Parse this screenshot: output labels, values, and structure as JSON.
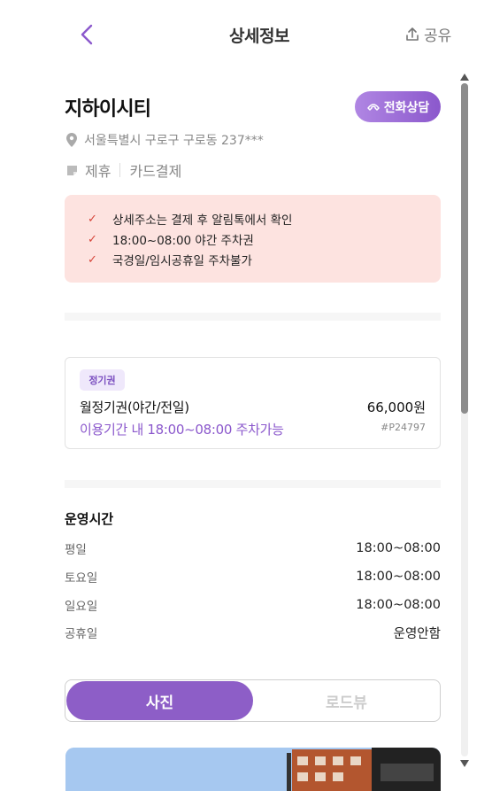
{
  "header": {
    "title": "상세정보",
    "share_label": "공유",
    "back_icon": "chevron-left-icon",
    "share_icon": "upload-icon"
  },
  "place": {
    "name": "지하이시티",
    "call_button_label": "전화상담",
    "address": "서울특별시 구로구 구로동 237***",
    "tags": [
      "제휴",
      "카드결제"
    ]
  },
  "notices": [
    "상세주소는 결제 후 알림톡에서 확인",
    "18:00~08:00 야간 주차권",
    "국경일/임시공휴일 주차불가"
  ],
  "pass": {
    "badge": "정기권",
    "name": "월정기권(야간/전일)",
    "price": "66,000원",
    "description": "이용기간 내 18:00~08:00 주차가능",
    "code": "#P24797"
  },
  "hours": {
    "title": "운영시간",
    "rows": [
      {
        "day": "평일",
        "time": "18:00~08:00"
      },
      {
        "day": "토요일",
        "time": "18:00~08:00"
      },
      {
        "day": "일요일",
        "time": "18:00~08:00"
      },
      {
        "day": "공휴일",
        "time": "운영안함"
      }
    ]
  },
  "tabs": {
    "photo": "사진",
    "roadview": "로드뷰"
  },
  "colors": {
    "accent": "#8d5ec7",
    "notice_bg": "#fde3e0",
    "check": "#d6453a"
  }
}
